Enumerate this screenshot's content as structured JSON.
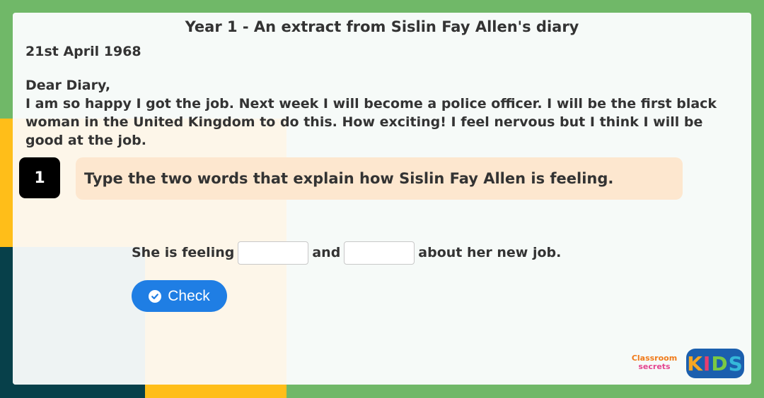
{
  "page": {
    "title": "Year 1 - An extract from Sislin Fay Allen's diary",
    "date": "21st April 1968",
    "greeting": "Dear Diary,",
    "body": "I am so happy I got the job. Next week I will become a police officer. I will be the first black woman in the United Kingdom to do this. How exciting! I feel nervous but I think I will be good at the job."
  },
  "question": {
    "number": "1",
    "prompt": "Type the two words that explain how Sislin Fay Allen is feeling."
  },
  "answer": {
    "prefix": "She is feeling",
    "conjunction": "and",
    "suffix": "about her new job.",
    "input1_value": "",
    "input2_value": ""
  },
  "check_button": {
    "label": "Check",
    "icon": "check-circle-icon"
  },
  "logos": {
    "classroom_secrets": [
      "Classroom",
      "secrets"
    ],
    "kids": [
      "K",
      "I",
      "D",
      "S"
    ]
  },
  "colors": {
    "background_green": "#70b868",
    "accent_yellow": "#ffbe19",
    "accent_teal": "#07404a",
    "question_box": "#fde7cf",
    "button_blue": "#1f7ee4"
  }
}
